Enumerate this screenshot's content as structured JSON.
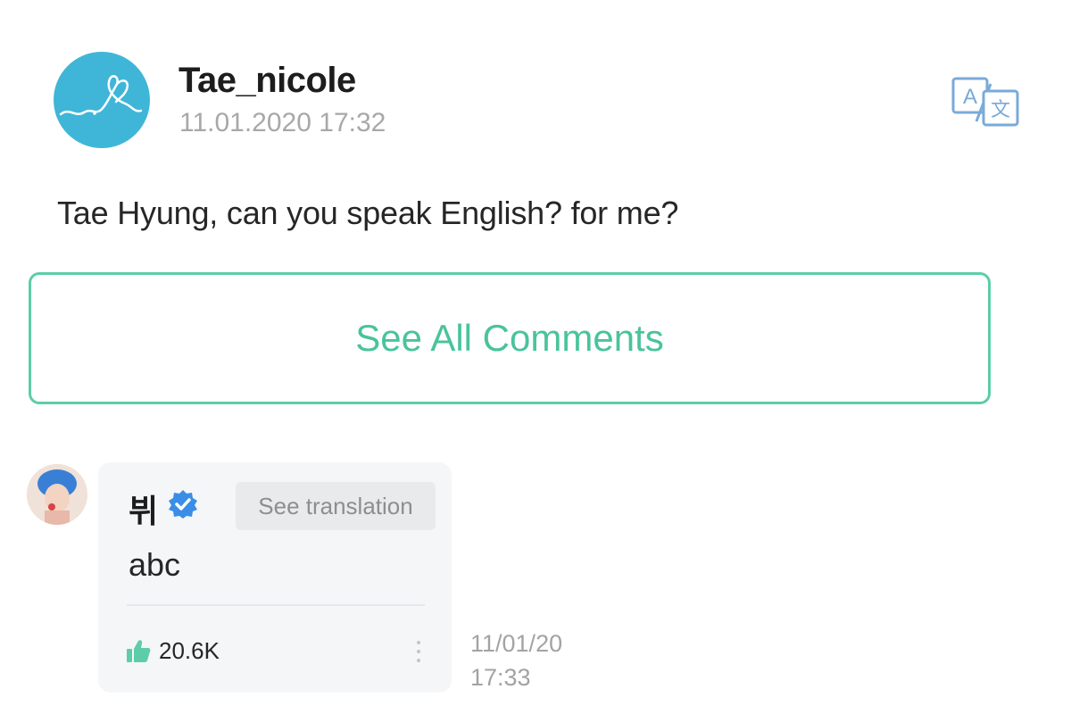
{
  "post": {
    "username": "Tae_nicole",
    "timestamp": "11.01.2020 17:32",
    "text": "Tae Hyung, can you speak English? for me?"
  },
  "see_all_label": "See All Comments",
  "comment": {
    "author": "뷔",
    "see_translation_label": "See translation",
    "text": "abc",
    "likes": "20.6K",
    "date": "11/01/20",
    "time": "17:33"
  },
  "colors": {
    "accent": "#4ac39c",
    "avatar_bg": "#3fb6d8",
    "verified": "#3a8ee6",
    "like": "#5ccda8",
    "translate_icon": "#7aaad8"
  },
  "icons": [
    "translate-icon",
    "verified-icon",
    "thumbs-up-icon",
    "more-options-icon"
  ]
}
